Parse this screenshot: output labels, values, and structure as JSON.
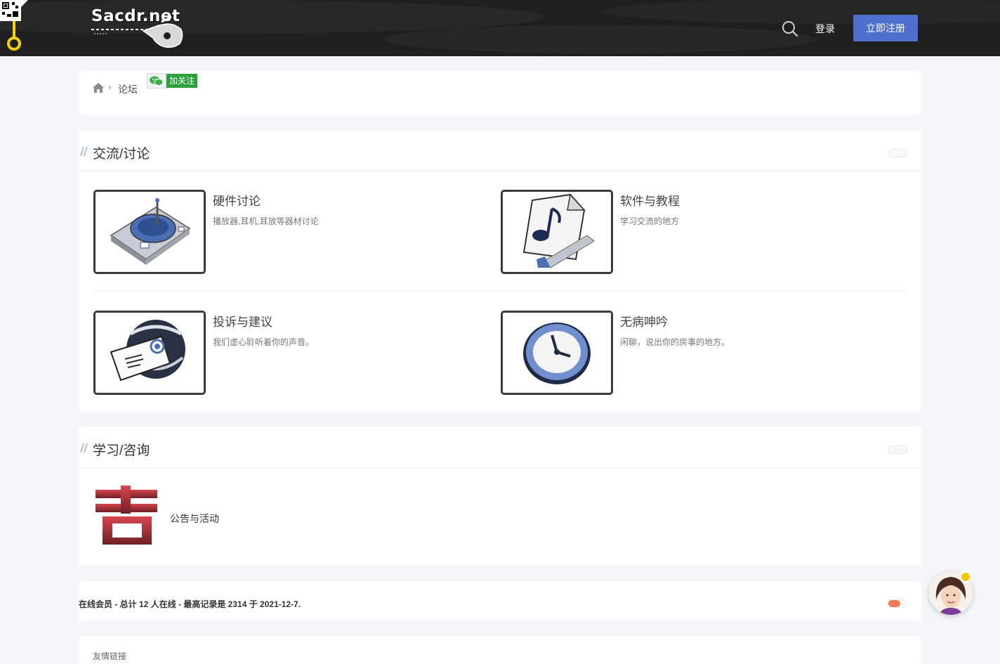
{
  "header": {
    "logo_text": "Sacdr.net",
    "login_label": "登录",
    "register_label": "立即注册"
  },
  "breadcrumb": {
    "forum_label": "论坛",
    "follow_label": "加关注"
  },
  "sections": [
    {
      "title": "交流/讨论",
      "forums": [
        {
          "name": "硬件讨论",
          "desc": "播放器,耳机,耳放等器材讨论",
          "icon": "turntable-icon"
        },
        {
          "name": "软件与教程",
          "desc": "学习交流的地方",
          "icon": "music-file-icon"
        },
        {
          "name": "投诉与建议",
          "desc": "我们虚心聆听着你的声音。",
          "icon": "mail-globe-icon"
        },
        {
          "name": "无病呻吟",
          "desc": "闲聊，说出你的房事的地方。",
          "icon": "clock-icon"
        }
      ]
    },
    {
      "title": "学习/咨询",
      "forums": [
        {
          "name": "公告与活动",
          "icon": "announcement-icon",
          "icon_glyph": "告"
        }
      ]
    }
  ],
  "online": {
    "text": "在线会员 - 总计 12 人在线 - 最高记录是 2314 于 2021-12-7."
  },
  "links": {
    "title": "友情链接"
  },
  "colors": {
    "header_bg": "#1f1f1f",
    "accent": "#4f6fce",
    "follow_green": "#2aa23a",
    "toggle_on": "#f07b56"
  }
}
